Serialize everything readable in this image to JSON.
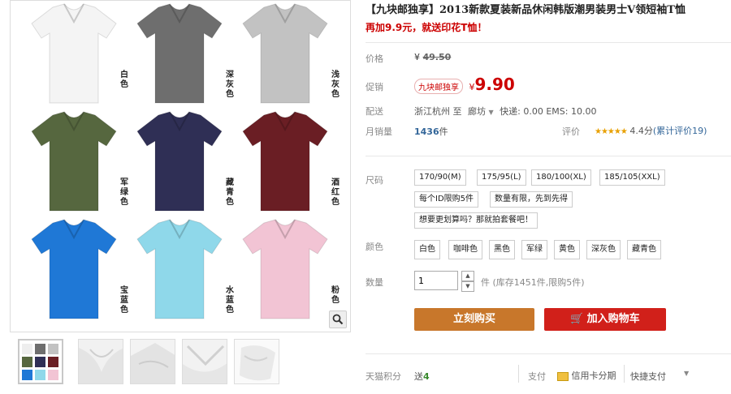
{
  "product": {
    "title": "【九块邮独享】2013新款夏装新品休闲韩版潮男装男士V领短袖T恤",
    "subtitle": "再加9.9元，就送印花T恤！"
  },
  "gallery": {
    "colors": [
      {
        "label": "白色",
        "hex": "#f4f4f4"
      },
      {
        "label": "深灰色",
        "hex": "#6e6e6e"
      },
      {
        "label": "浅灰色",
        "hex": "#c2c2c2"
      },
      {
        "label": "军绿色",
        "hex": "#56673f"
      },
      {
        "label": "藏青色",
        "hex": "#2f2f55"
      },
      {
        "label": "酒红色",
        "hex": "#6a1e24"
      },
      {
        "label": "宝蓝色",
        "hex": "#1f78d6"
      },
      {
        "label": "水蓝色",
        "hex": "#8fd8ea"
      },
      {
        "label": "粉色",
        "hex": "#f2c4d4"
      }
    ]
  },
  "price": {
    "label": "价格",
    "currency": "¥",
    "original": "49.50"
  },
  "promo": {
    "label": "促销",
    "tag": "九块邮独享",
    "currency": "¥",
    "price": "9.90"
  },
  "shipping": {
    "label": "配送",
    "from": "浙江杭州",
    "to_word": "至",
    "dest": "廊坊",
    "fees": "快递: 0.00  EMS: 10.00"
  },
  "sales": {
    "label": "月销量",
    "count": "1436",
    "unit": "件",
    "rating_label": "评价",
    "rating": "4.4分",
    "reviews": "(累计评价19)"
  },
  "size": {
    "label": "尺码",
    "options": [
      "170/90(M)",
      "175/95(L)",
      "180/100(XL)",
      "185/105(XXL)"
    ],
    "notes": [
      "每个ID限购5件",
      "数量有限，先到先得",
      "想要更划算吗？那就拍套餐吧！"
    ]
  },
  "color": {
    "label": "颜色",
    "options": [
      "白色",
      "咖啡色",
      "黑色",
      "军绿",
      "黄色",
      "深灰色",
      "藏青色"
    ]
  },
  "quantity": {
    "label": "数量",
    "value": "1",
    "stock_text": "件 (库存1451件,限购5件)"
  },
  "buttons": {
    "buy_now": "立刻购买",
    "add_cart": "加入购物车"
  },
  "footer": {
    "points_label": "天猫积分",
    "points_prefix": "送",
    "points_value": "4",
    "pay_label": "支付",
    "credit_card": "信用卡分期",
    "quick_pay": "快捷支付"
  },
  "colors_meta": {
    "accent_red": "#cc0000",
    "buy_orange": "#c8772b",
    "cart_red": "#d1201a"
  }
}
